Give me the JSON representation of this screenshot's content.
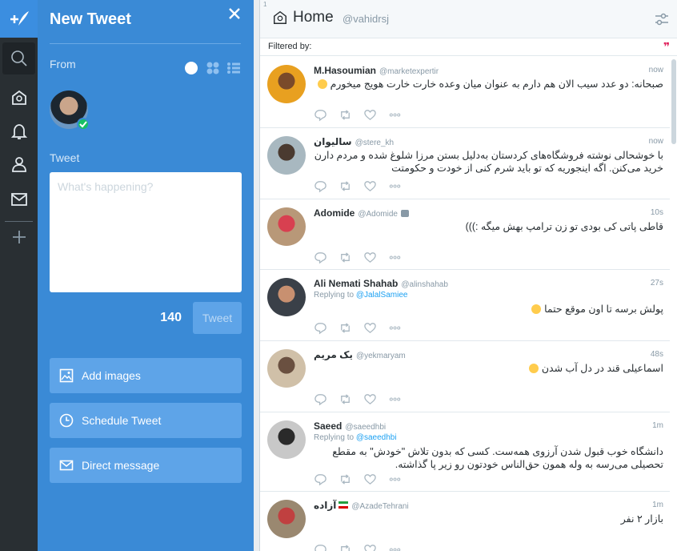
{
  "rail": {
    "compose_icon": "feather-plus-icon",
    "items": [
      "search-icon",
      "home-icon",
      "notifications-icon",
      "profile-icon",
      "messages-icon",
      "add-column-icon"
    ]
  },
  "compose": {
    "title": "New Tweet",
    "from_label": "From",
    "tweet_label": "Tweet",
    "placeholder": "What's happening?",
    "char_count": "140",
    "tweet_button": "Tweet",
    "add_images": "Add images",
    "schedule": "Schedule Tweet",
    "direct_message": "Direct message"
  },
  "column": {
    "number": "1",
    "title": "Home",
    "handle": "@vahidrsj",
    "filtered_label": "Filtered by:"
  },
  "tweets": [
    {
      "name": "M.Hasoumian",
      "handle": "@marketexpertir",
      "time": "now",
      "text": "صبحانه: دو عدد سیب الان هم دارم به عنوان میان وعده خارت خارت هویج میخورم",
      "emoji": "smile",
      "avatar_colors": [
        "#e8a020",
        "#7a4a2a"
      ]
    },
    {
      "name": "سالیوان",
      "handle": "@stere_kh",
      "time": "now",
      "text": "با خوشحالی نوشته فروشگاه‌های کردستان به‌دلیل بستن مرزا شلوغ شده و مردم دارن خرید می‌کنن. اگه اینجوریه که تو باید شرم کنی از خودت و حکومتت",
      "avatar_colors": [
        "#a8b8c0",
        "#4a3a30"
      ]
    },
    {
      "name": "Adomide",
      "handle": "@Adomide",
      "time": "10s",
      "text": "قاطی پاتی کی بودی تو زن ترامپ بهش میگه :)))",
      "avatar_colors": [
        "#b89878",
        "#d84050"
      ]
    },
    {
      "name": "Ali Nemati Shahab",
      "handle": "@alinshahab",
      "time": "27s",
      "reply_prefix": "Replying to",
      "reply_to": "@JalalSamiee",
      "text": "پولش برسه تا اون موقع حتما",
      "emoji": "wink",
      "avatar_colors": [
        "#3a4048",
        "#c89070"
      ]
    },
    {
      "name": "یک مریم",
      "handle": "@yekmaryam",
      "time": "48s",
      "text": "اسماعیلی قند در دل آب شدن",
      "emoji": "relieved",
      "avatar_colors": [
        "#d0c0a8",
        "#6a5040"
      ]
    },
    {
      "name": "Saeed",
      "handle": "@saeedhbi",
      "time": "1m",
      "reply_prefix": "Replying to",
      "reply_to": "@saeedhbi",
      "text": "دانشگاه خوب قبول شدن آرزوی همه‌ست. کسی که بدون تلاش \"خودش\" به مقطع تحصیلی می‌رسه به وله همون حق‌الناس خودتون رو زیر پا گذاشته.",
      "avatar_colors": [
        "#c8c8c8",
        "#2a2a2a"
      ]
    },
    {
      "name": "آزاده",
      "handle": "@AzadeTehrani",
      "time": "1m",
      "flag": "iran",
      "text": "بازار ۲ نفر",
      "avatar_colors": [
        "#9a8870",
        "#c04040"
      ]
    }
  ]
}
